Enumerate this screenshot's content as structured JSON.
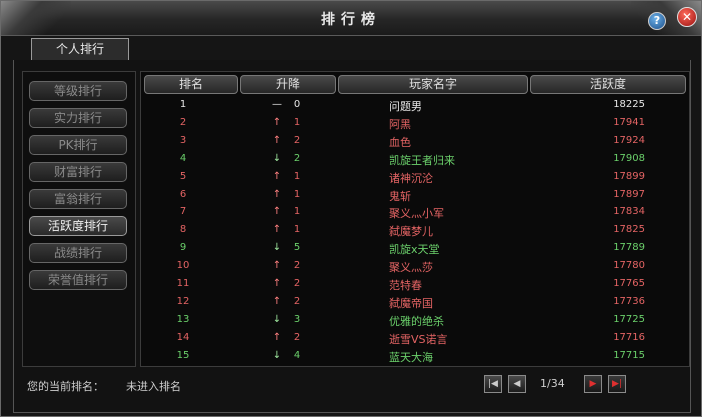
{
  "window": {
    "title": "排行榜",
    "help_label": "?",
    "close_label": "✕"
  },
  "tabs": [
    {
      "label": "个人排行"
    }
  ],
  "sidebar": {
    "items": [
      {
        "label": "等级排行"
      },
      {
        "label": "实力排行"
      },
      {
        "label": "PK排行"
      },
      {
        "label": "财富排行"
      },
      {
        "label": "富翁排行"
      },
      {
        "label": "活跃度排行",
        "active": true
      },
      {
        "label": "战绩排行"
      },
      {
        "label": "荣誉值排行"
      }
    ]
  },
  "table": {
    "headers": {
      "rank": "排名",
      "change": "升降",
      "name": "玩家名字",
      "score": "活跃度"
    },
    "rows": [
      {
        "rank": "1",
        "arrow": "—",
        "change": "0",
        "name": "问题男",
        "score": "18225",
        "trend": "same"
      },
      {
        "rank": "2",
        "arrow": "↑",
        "change": "1",
        "name": "阿黑",
        "score": "17941",
        "trend": "up"
      },
      {
        "rank": "3",
        "arrow": "↑",
        "change": "2",
        "name": "血色",
        "score": "17924",
        "trend": "up"
      },
      {
        "rank": "4",
        "arrow": "↓",
        "change": "2",
        "name": "凯旋王者归来",
        "score": "17908",
        "trend": "down"
      },
      {
        "rank": "5",
        "arrow": "↑",
        "change": "1",
        "name": "诸神沉沦",
        "score": "17899",
        "trend": "up"
      },
      {
        "rank": "6",
        "arrow": "↑",
        "change": "1",
        "name": "鬼斩",
        "score": "17897",
        "trend": "up"
      },
      {
        "rank": "7",
        "arrow": "↑",
        "change": "1",
        "name": "聚义灬小军",
        "score": "17834",
        "trend": "up"
      },
      {
        "rank": "8",
        "arrow": "↑",
        "change": "1",
        "name": "弑魔梦儿",
        "score": "17825",
        "trend": "up"
      },
      {
        "rank": "9",
        "arrow": "↓",
        "change": "5",
        "name": "凯旋x天堂",
        "score": "17789",
        "trend": "down"
      },
      {
        "rank": "10",
        "arrow": "↑",
        "change": "2",
        "name": "聚义灬莎",
        "score": "17780",
        "trend": "up"
      },
      {
        "rank": "11",
        "arrow": "↑",
        "change": "2",
        "name": "范特春",
        "score": "17765",
        "trend": "up"
      },
      {
        "rank": "12",
        "arrow": "↑",
        "change": "2",
        "name": "弑魔帝国",
        "score": "17736",
        "trend": "up"
      },
      {
        "rank": "13",
        "arrow": "↓",
        "change": "3",
        "name": "优雅的绝杀",
        "score": "17725",
        "trend": "down"
      },
      {
        "rank": "14",
        "arrow": "↑",
        "change": "2",
        "name": "逝雪VS诺言",
        "score": "17716",
        "trend": "up"
      },
      {
        "rank": "15",
        "arrow": "↓",
        "change": "4",
        "name": "蓝天大海",
        "score": "17715",
        "trend": "down"
      }
    ]
  },
  "footer": {
    "current_rank_label": "您的当前排名：",
    "current_rank_value": "未进入排名",
    "page_indicator": "1/34"
  },
  "pagination": {
    "first_icon": "first-page-icon",
    "prev_icon": "prev-page-icon",
    "next_icon": "next-page-icon",
    "last_icon": "last-page-icon"
  },
  "colors": {
    "up": "#e46464",
    "down": "#6bd06b",
    "same": "#e8e8e8"
  }
}
